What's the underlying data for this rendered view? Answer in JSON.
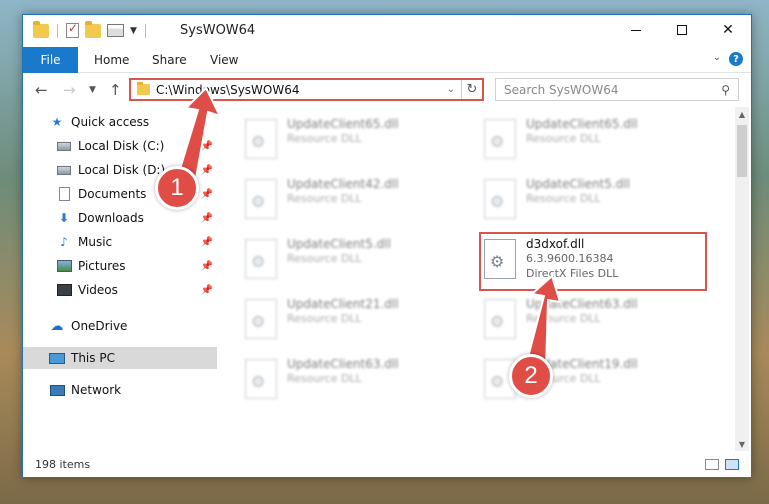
{
  "window": {
    "title": "SysWOW64",
    "minimize_glyph": "—",
    "maximize_glyph": "☐",
    "close_glyph": "✕"
  },
  "ribbon": {
    "tabs": [
      "File",
      "Home",
      "Share",
      "View"
    ]
  },
  "address_bar": {
    "path": "C:\\Windows\\SysWOW64",
    "search_placeholder": "Search SysWOW64"
  },
  "nav_pane": {
    "items": [
      {
        "label": "Quick access",
        "icon": "star-icon",
        "pinned": false
      },
      {
        "label": "Local Disk (C:)",
        "icon": "disk-icon",
        "pinned": true
      },
      {
        "label": "Local Disk (D:)",
        "icon": "disk-icon",
        "pinned": true
      },
      {
        "label": "Documents",
        "icon": "documents-icon",
        "pinned": true
      },
      {
        "label": "Downloads",
        "icon": "downloads-icon",
        "pinned": true
      },
      {
        "label": "Music",
        "icon": "music-icon",
        "pinned": true
      },
      {
        "label": "Pictures",
        "icon": "pictures-icon",
        "pinned": true
      },
      {
        "label": "Videos",
        "icon": "videos-icon",
        "pinned": true
      },
      {
        "label": "OneDrive",
        "icon": "onedrive-icon",
        "pinned": false
      },
      {
        "label": "This PC",
        "icon": "this-pc-icon",
        "pinned": false,
        "selected": true
      },
      {
        "label": "Network",
        "icon": "network-icon",
        "pinned": false
      }
    ]
  },
  "files": [
    {
      "name": "UpdateClient65.dll",
      "type": "Resource DLL",
      "blurred": true
    },
    {
      "name": "UpdateClient65.dll",
      "type": "Resource DLL",
      "blurred": true
    },
    {
      "name": "UpdateClient42.dll",
      "type": "Resource DLL",
      "blurred": true
    },
    {
      "name": "UpdateClient5.dll",
      "type": "Resource DLL",
      "blurred": true
    },
    {
      "name": "UpdateClient5.dll",
      "type": "Resource DLL",
      "blurred": true
    },
    {
      "name": "d3dxof.dll",
      "version": "6.3.9600.16384",
      "type": "DirectX Files DLL",
      "blurred": false
    },
    {
      "name": "UpdateClient21.dll",
      "type": "Resource DLL",
      "blurred": true
    },
    {
      "name": "UpdateClient63.dll",
      "type": "Resource DLL",
      "blurred": true
    },
    {
      "name": "UpdateClient63.dll",
      "type": "Resource DLL",
      "blurred": true
    },
    {
      "name": "UpdateClient19.dll",
      "type": "Resource DLL",
      "blurred": true
    }
  ],
  "status": {
    "item_count": "198 items"
  },
  "annotations": {
    "step1": "1",
    "step2": "2",
    "color": "#e04d47"
  }
}
